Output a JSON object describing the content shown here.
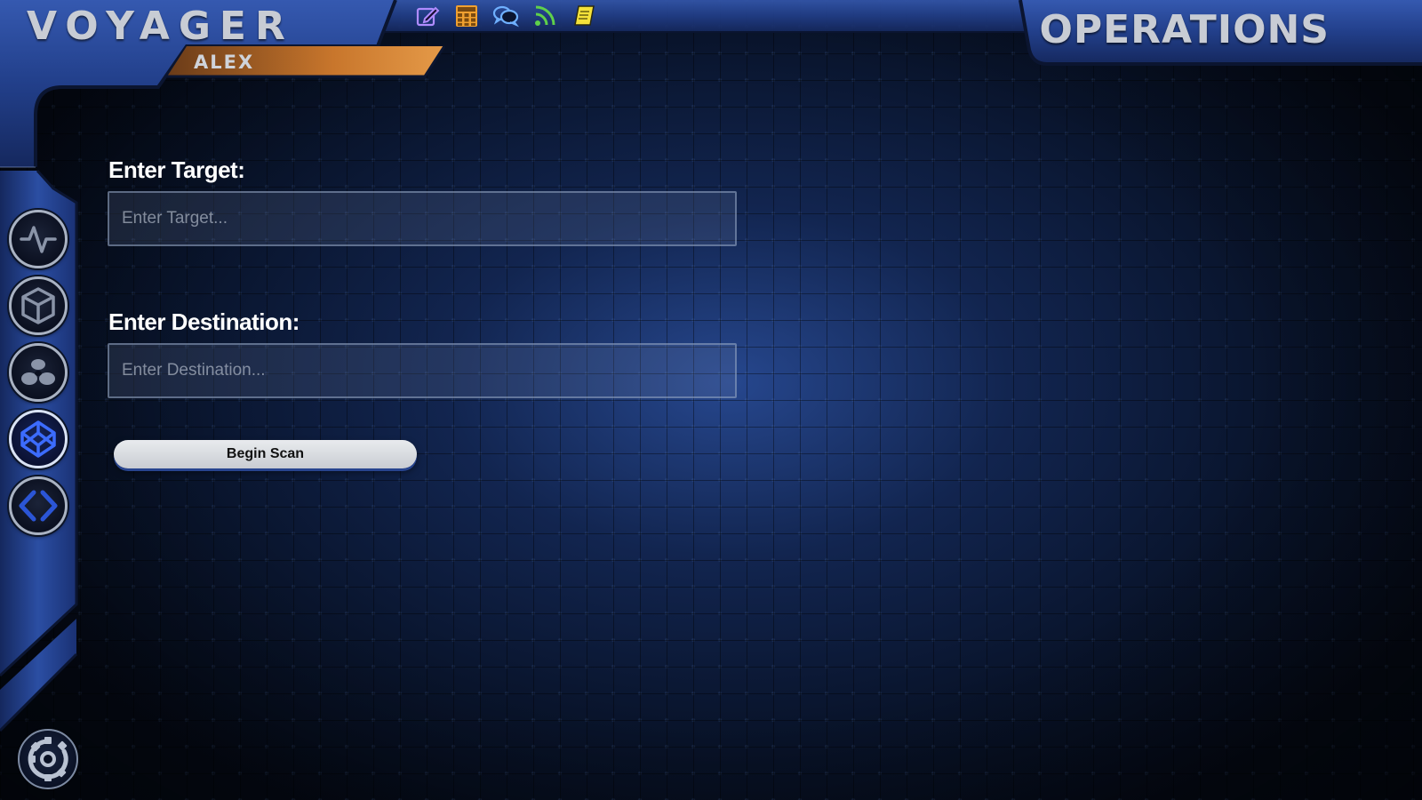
{
  "header": {
    "app_title": "VOYAGER",
    "user_name": "ALEX",
    "section_title": "OPERATIONS"
  },
  "toolbar": {
    "items": [
      {
        "icon": "edit-icon",
        "color": "#b08cff"
      },
      {
        "icon": "calculator-icon",
        "color": "#f0a030"
      },
      {
        "icon": "chat-icon",
        "color": "#6fb0ff"
      },
      {
        "icon": "rss-feed-icon",
        "color": "#5fd04a"
      },
      {
        "icon": "notebook-icon",
        "color": "#f5e23a"
      }
    ]
  },
  "sidebar": {
    "items": [
      {
        "icon": "activity-pulse-icon"
      },
      {
        "icon": "cube-icon"
      },
      {
        "icon": "cluster-icon"
      },
      {
        "icon": "codepen-icon",
        "active": true
      },
      {
        "icon": "code-brackets-icon"
      }
    ],
    "settings_icon": "settings-gear-icon"
  },
  "form": {
    "target_label": "Enter Target:",
    "target_placeholder": "Enter Target...",
    "target_value": "",
    "destination_label": "Enter Destination:",
    "destination_placeholder": "Enter Destination...",
    "destination_value": "",
    "submit_label": "Begin Scan"
  },
  "colors": {
    "frame_blue": "#2a4a9a",
    "accent_orange": "#d07a2c",
    "active_icon": "#3c6cff",
    "background": "#0b1a3a"
  }
}
